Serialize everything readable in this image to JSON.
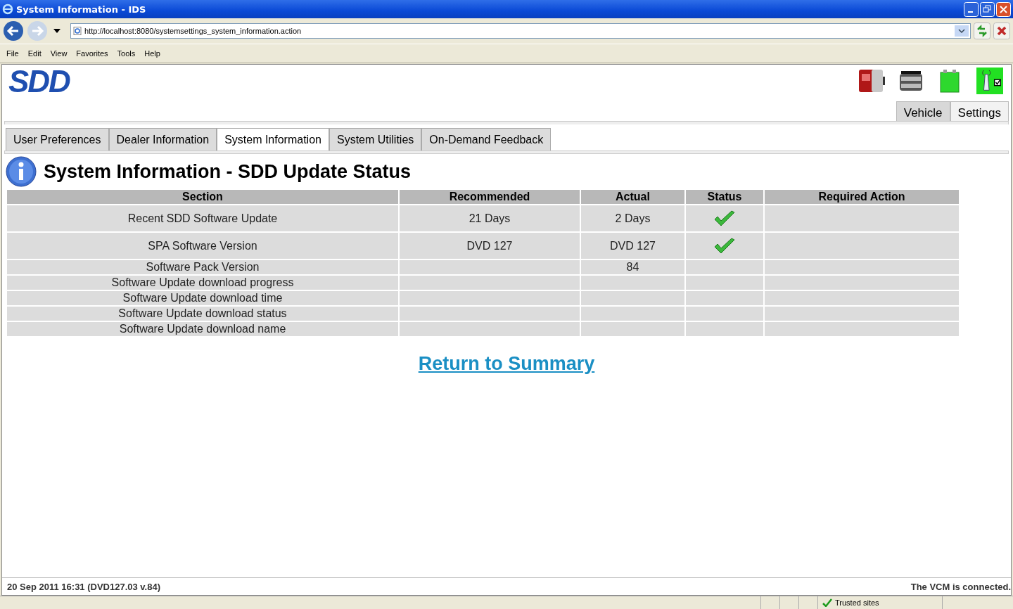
{
  "window": {
    "title": "System Information - IDS"
  },
  "address_bar": {
    "url": "http://localhost:8080/systemsettings_system_information.action"
  },
  "menu": [
    "File",
    "Edit",
    "View",
    "Favorites",
    "Tools",
    "Help"
  ],
  "logo": "SDD",
  "top_tabs": [
    {
      "label": "Vehicle",
      "selected": false
    },
    {
      "label": "Settings",
      "selected": true
    }
  ],
  "tabs": [
    {
      "label": "User Preferences",
      "selected": false
    },
    {
      "label": "Dealer Information",
      "selected": false
    },
    {
      "label": "System Information",
      "selected": true
    },
    {
      "label": "System Utilities",
      "selected": false
    },
    {
      "label": "On-Demand Feedback",
      "selected": false
    }
  ],
  "heading": "System Information - SDD Update Status",
  "table": {
    "columns": [
      "Section",
      "Recommended",
      "Actual",
      "Status",
      "Required Action"
    ],
    "rows": [
      {
        "section": "Recent SDD Software Update",
        "recommended": "21 Days",
        "actual": "2 Days",
        "status_ok": true
      },
      {
        "section": "SPA Software Version",
        "recommended": "DVD 127",
        "actual": "DVD 127",
        "status_ok": true
      },
      {
        "section": "Software Pack Version",
        "recommended": "",
        "actual": "84",
        "status_ok": false
      },
      {
        "section": "Software Update download progress",
        "recommended": "",
        "actual": "",
        "status_ok": false
      },
      {
        "section": "Software Update download time",
        "recommended": "",
        "actual": "",
        "status_ok": false
      },
      {
        "section": "Software Update download status",
        "recommended": "",
        "actual": "",
        "status_ok": false
      },
      {
        "section": "Software Update download name",
        "recommended": "",
        "actual": "",
        "status_ok": false
      }
    ]
  },
  "return_link": "Return to Summary",
  "footer": {
    "left": "20 Sep 2011 16:31 (DVD127.03 v.84)",
    "right": "The VCM is connected."
  },
  "status_bar": {
    "zone": "Trusted sites"
  }
}
